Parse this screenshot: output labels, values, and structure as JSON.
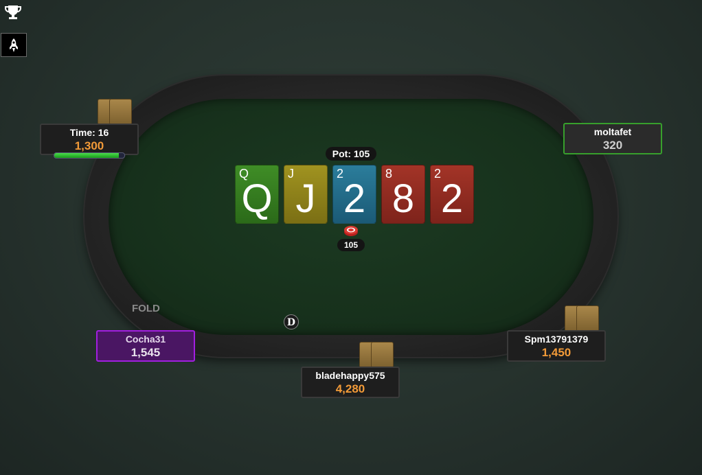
{
  "toolbar": {
    "trophy_icon": "trophy-icon",
    "rocket_icon": "rocket-icon"
  },
  "pot": {
    "label": "Pot: 105",
    "chips_amount": "105"
  },
  "board": [
    {
      "rank_corner": "Q",
      "rank_big": "Q",
      "color": "green"
    },
    {
      "rank_corner": "J",
      "rank_big": "J",
      "color": "yellow"
    },
    {
      "rank_corner": "2",
      "rank_big": "2",
      "color": "blue"
    },
    {
      "rank_corner": "8",
      "rank_big": "8",
      "color": "red"
    },
    {
      "rank_corner": "2",
      "rank_big": "2",
      "color": "red"
    }
  ],
  "dealer_button": "D",
  "fold_label": "FOLD",
  "seats": {
    "top_left": {
      "name": "Time: 16",
      "stack": "1,300",
      "timer_fraction": 0.92
    },
    "top_right": {
      "name": "moltafet",
      "stack": "320"
    },
    "bottom_left": {
      "name": "Cocha31",
      "stack": "1,545"
    },
    "bottom_center": {
      "name": "bladehappy575",
      "stack": "4,280"
    },
    "bottom_right": {
      "name": "Spm13791379",
      "stack": "1,450"
    }
  },
  "colors": {
    "active_seat_border": "#37a02c",
    "hero_seat_border": "#a21fe0",
    "stack_orange": "#f29a38",
    "felt": "#17311c"
  }
}
